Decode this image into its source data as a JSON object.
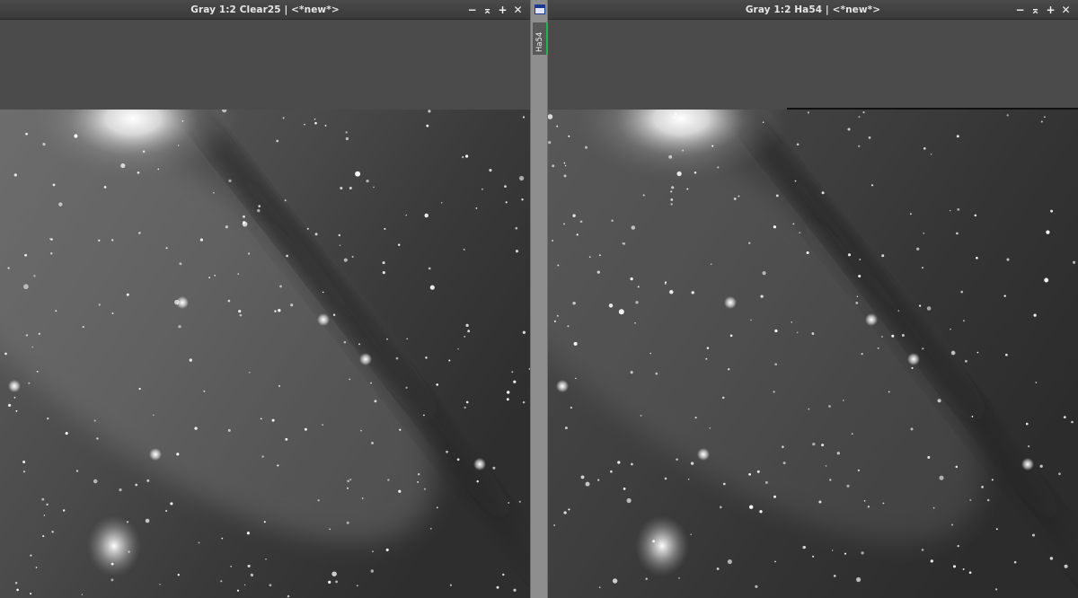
{
  "windows": [
    {
      "title": "Gray 1:2 Clear25 | <*new*>",
      "buttons": [
        "−",
        "⌅",
        "+",
        "✕"
      ]
    },
    {
      "title": "Gray 1:2 Ha54 | <*new*>",
      "buttons": [
        "−",
        "⌅",
        "+",
        "✕"
      ]
    }
  ],
  "side_tab": {
    "label": "Ha54",
    "icon": "window-icon"
  },
  "colors": {
    "accent_tab": "#1fb35a",
    "panel": "#4b4b4b",
    "gutter": "#8e8e8e"
  }
}
